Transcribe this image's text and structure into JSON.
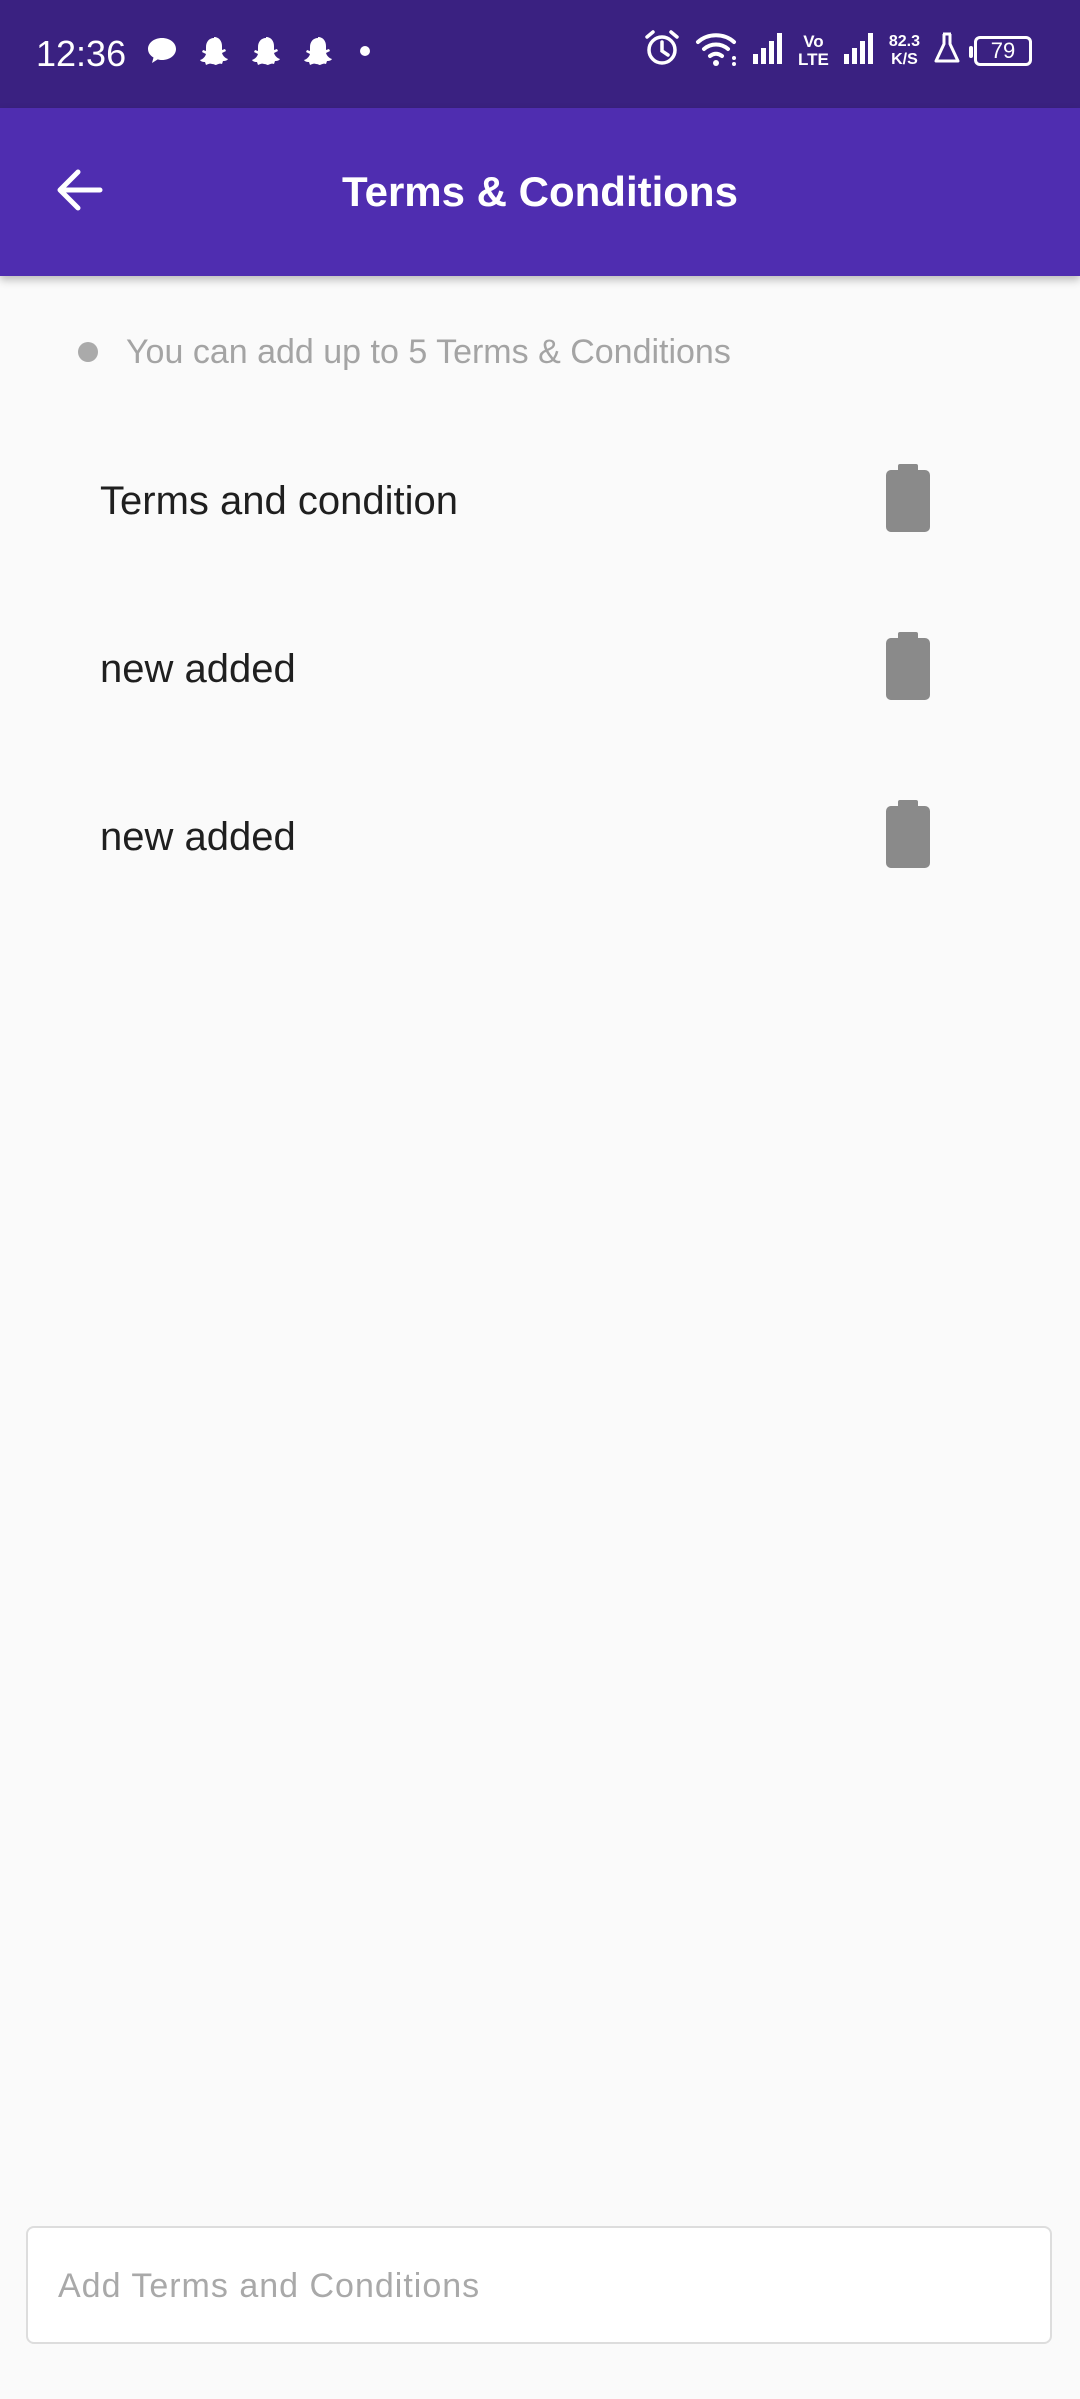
{
  "status_bar": {
    "time": "12:36",
    "notification_icons": [
      "chat-bubble-icon",
      "snapchat-icon",
      "snapchat-icon",
      "snapchat-icon",
      "dot-icon"
    ],
    "network_type_top": "Vo",
    "network_type_bottom": "LTE",
    "speed_value": "82.3",
    "speed_unit": "K/S",
    "battery_level": "79"
  },
  "app_bar": {
    "title": "Terms & Conditions",
    "back_icon": "arrow-left-icon"
  },
  "hint": {
    "text": "You can add up to 5 Terms & Conditions"
  },
  "terms": [
    {
      "text": "Terms and condition",
      "action_icon": "delete-icon"
    },
    {
      "text": "new added",
      "action_icon": "delete-icon"
    },
    {
      "text": "new added",
      "action_icon": "delete-icon"
    }
  ],
  "input": {
    "placeholder": "Add Terms and Conditions",
    "value": ""
  },
  "colors": {
    "status_bar": "#3a2181",
    "app_bar": "#4f2db0",
    "background": "#fafafa",
    "icon_gray": "#8a8a8a"
  }
}
